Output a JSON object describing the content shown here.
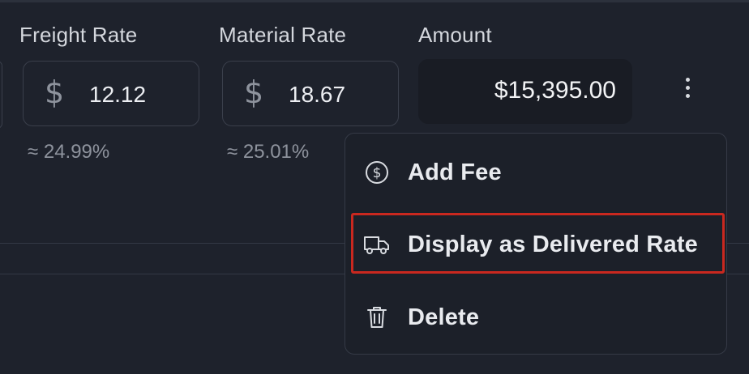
{
  "columns": {
    "freight": {
      "label": "Freight Rate",
      "currency": "$",
      "value": "12.12",
      "pct": "≈ 24.99%"
    },
    "material": {
      "label": "Material Rate",
      "currency": "$",
      "value": "18.67",
      "pct": "≈ 25.01%"
    },
    "amount": {
      "label": "Amount",
      "value": "$15,395.00"
    }
  },
  "menu": {
    "items": [
      {
        "label": "Add Fee",
        "icon": "dollar-circle-icon"
      },
      {
        "label": "Display as Delivered Rate",
        "icon": "truck-icon",
        "highlighted": true
      },
      {
        "label": "Delete",
        "icon": "trash-icon"
      }
    ]
  },
  "colors": {
    "background": "#1e222c",
    "highlight": "#c9281f",
    "text": "#e6e8ec",
    "muted": "#8e939d"
  }
}
